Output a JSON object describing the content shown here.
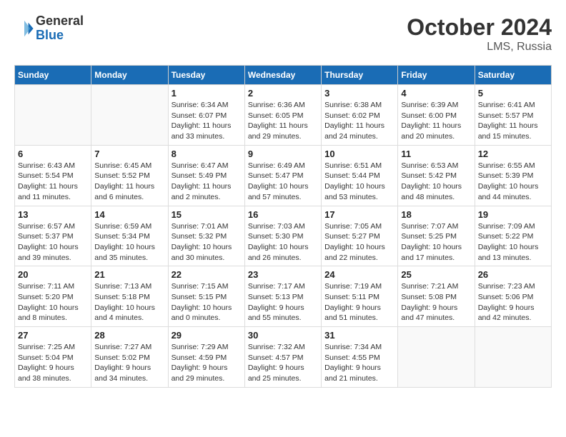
{
  "logo": {
    "line1": "General",
    "line2": "Blue"
  },
  "title": "October 2024",
  "subtitle": "LMS, Russia",
  "days_of_week": [
    "Sunday",
    "Monday",
    "Tuesday",
    "Wednesday",
    "Thursday",
    "Friday",
    "Saturday"
  ],
  "weeks": [
    [
      {
        "day": "",
        "sunrise": "",
        "sunset": "",
        "daylight": "",
        "empty": true
      },
      {
        "day": "",
        "sunrise": "",
        "sunset": "",
        "daylight": "",
        "empty": true
      },
      {
        "day": "1",
        "sunrise": "Sunrise: 6:34 AM",
        "sunset": "Sunset: 6:07 PM",
        "daylight": "Daylight: 11 hours and 33 minutes.",
        "empty": false
      },
      {
        "day": "2",
        "sunrise": "Sunrise: 6:36 AM",
        "sunset": "Sunset: 6:05 PM",
        "daylight": "Daylight: 11 hours and 29 minutes.",
        "empty": false
      },
      {
        "day": "3",
        "sunrise": "Sunrise: 6:38 AM",
        "sunset": "Sunset: 6:02 PM",
        "daylight": "Daylight: 11 hours and 24 minutes.",
        "empty": false
      },
      {
        "day": "4",
        "sunrise": "Sunrise: 6:39 AM",
        "sunset": "Sunset: 6:00 PM",
        "daylight": "Daylight: 11 hours and 20 minutes.",
        "empty": false
      },
      {
        "day": "5",
        "sunrise": "Sunrise: 6:41 AM",
        "sunset": "Sunset: 5:57 PM",
        "daylight": "Daylight: 11 hours and 15 minutes.",
        "empty": false
      }
    ],
    [
      {
        "day": "6",
        "sunrise": "Sunrise: 6:43 AM",
        "sunset": "Sunset: 5:54 PM",
        "daylight": "Daylight: 11 hours and 11 minutes.",
        "empty": false
      },
      {
        "day": "7",
        "sunrise": "Sunrise: 6:45 AM",
        "sunset": "Sunset: 5:52 PM",
        "daylight": "Daylight: 11 hours and 6 minutes.",
        "empty": false
      },
      {
        "day": "8",
        "sunrise": "Sunrise: 6:47 AM",
        "sunset": "Sunset: 5:49 PM",
        "daylight": "Daylight: 11 hours and 2 minutes.",
        "empty": false
      },
      {
        "day": "9",
        "sunrise": "Sunrise: 6:49 AM",
        "sunset": "Sunset: 5:47 PM",
        "daylight": "Daylight: 10 hours and 57 minutes.",
        "empty": false
      },
      {
        "day": "10",
        "sunrise": "Sunrise: 6:51 AM",
        "sunset": "Sunset: 5:44 PM",
        "daylight": "Daylight: 10 hours and 53 minutes.",
        "empty": false
      },
      {
        "day": "11",
        "sunrise": "Sunrise: 6:53 AM",
        "sunset": "Sunset: 5:42 PM",
        "daylight": "Daylight: 10 hours and 48 minutes.",
        "empty": false
      },
      {
        "day": "12",
        "sunrise": "Sunrise: 6:55 AM",
        "sunset": "Sunset: 5:39 PM",
        "daylight": "Daylight: 10 hours and 44 minutes.",
        "empty": false
      }
    ],
    [
      {
        "day": "13",
        "sunrise": "Sunrise: 6:57 AM",
        "sunset": "Sunset: 5:37 PM",
        "daylight": "Daylight: 10 hours and 39 minutes.",
        "empty": false
      },
      {
        "day": "14",
        "sunrise": "Sunrise: 6:59 AM",
        "sunset": "Sunset: 5:34 PM",
        "daylight": "Daylight: 10 hours and 35 minutes.",
        "empty": false
      },
      {
        "day": "15",
        "sunrise": "Sunrise: 7:01 AM",
        "sunset": "Sunset: 5:32 PM",
        "daylight": "Daylight: 10 hours and 30 minutes.",
        "empty": false
      },
      {
        "day": "16",
        "sunrise": "Sunrise: 7:03 AM",
        "sunset": "Sunset: 5:30 PM",
        "daylight": "Daylight: 10 hours and 26 minutes.",
        "empty": false
      },
      {
        "day": "17",
        "sunrise": "Sunrise: 7:05 AM",
        "sunset": "Sunset: 5:27 PM",
        "daylight": "Daylight: 10 hours and 22 minutes.",
        "empty": false
      },
      {
        "day": "18",
        "sunrise": "Sunrise: 7:07 AM",
        "sunset": "Sunset: 5:25 PM",
        "daylight": "Daylight: 10 hours and 17 minutes.",
        "empty": false
      },
      {
        "day": "19",
        "sunrise": "Sunrise: 7:09 AM",
        "sunset": "Sunset: 5:22 PM",
        "daylight": "Daylight: 10 hours and 13 minutes.",
        "empty": false
      }
    ],
    [
      {
        "day": "20",
        "sunrise": "Sunrise: 7:11 AM",
        "sunset": "Sunset: 5:20 PM",
        "daylight": "Daylight: 10 hours and 8 minutes.",
        "empty": false
      },
      {
        "day": "21",
        "sunrise": "Sunrise: 7:13 AM",
        "sunset": "Sunset: 5:18 PM",
        "daylight": "Daylight: 10 hours and 4 minutes.",
        "empty": false
      },
      {
        "day": "22",
        "sunrise": "Sunrise: 7:15 AM",
        "sunset": "Sunset: 5:15 PM",
        "daylight": "Daylight: 10 hours and 0 minutes.",
        "empty": false
      },
      {
        "day": "23",
        "sunrise": "Sunrise: 7:17 AM",
        "sunset": "Sunset: 5:13 PM",
        "daylight": "Daylight: 9 hours and 55 minutes.",
        "empty": false
      },
      {
        "day": "24",
        "sunrise": "Sunrise: 7:19 AM",
        "sunset": "Sunset: 5:11 PM",
        "daylight": "Daylight: 9 hours and 51 minutes.",
        "empty": false
      },
      {
        "day": "25",
        "sunrise": "Sunrise: 7:21 AM",
        "sunset": "Sunset: 5:08 PM",
        "daylight": "Daylight: 9 hours and 47 minutes.",
        "empty": false
      },
      {
        "day": "26",
        "sunrise": "Sunrise: 7:23 AM",
        "sunset": "Sunset: 5:06 PM",
        "daylight": "Daylight: 9 hours and 42 minutes.",
        "empty": false
      }
    ],
    [
      {
        "day": "27",
        "sunrise": "Sunrise: 7:25 AM",
        "sunset": "Sunset: 5:04 PM",
        "daylight": "Daylight: 9 hours and 38 minutes.",
        "empty": false
      },
      {
        "day": "28",
        "sunrise": "Sunrise: 7:27 AM",
        "sunset": "Sunset: 5:02 PM",
        "daylight": "Daylight: 9 hours and 34 minutes.",
        "empty": false
      },
      {
        "day": "29",
        "sunrise": "Sunrise: 7:29 AM",
        "sunset": "Sunset: 4:59 PM",
        "daylight": "Daylight: 9 hours and 29 minutes.",
        "empty": false
      },
      {
        "day": "30",
        "sunrise": "Sunrise: 7:32 AM",
        "sunset": "Sunset: 4:57 PM",
        "daylight": "Daylight: 9 hours and 25 minutes.",
        "empty": false
      },
      {
        "day": "31",
        "sunrise": "Sunrise: 7:34 AM",
        "sunset": "Sunset: 4:55 PM",
        "daylight": "Daylight: 9 hours and 21 minutes.",
        "empty": false
      },
      {
        "day": "",
        "sunrise": "",
        "sunset": "",
        "daylight": "",
        "empty": true
      },
      {
        "day": "",
        "sunrise": "",
        "sunset": "",
        "daylight": "",
        "empty": true
      }
    ]
  ]
}
